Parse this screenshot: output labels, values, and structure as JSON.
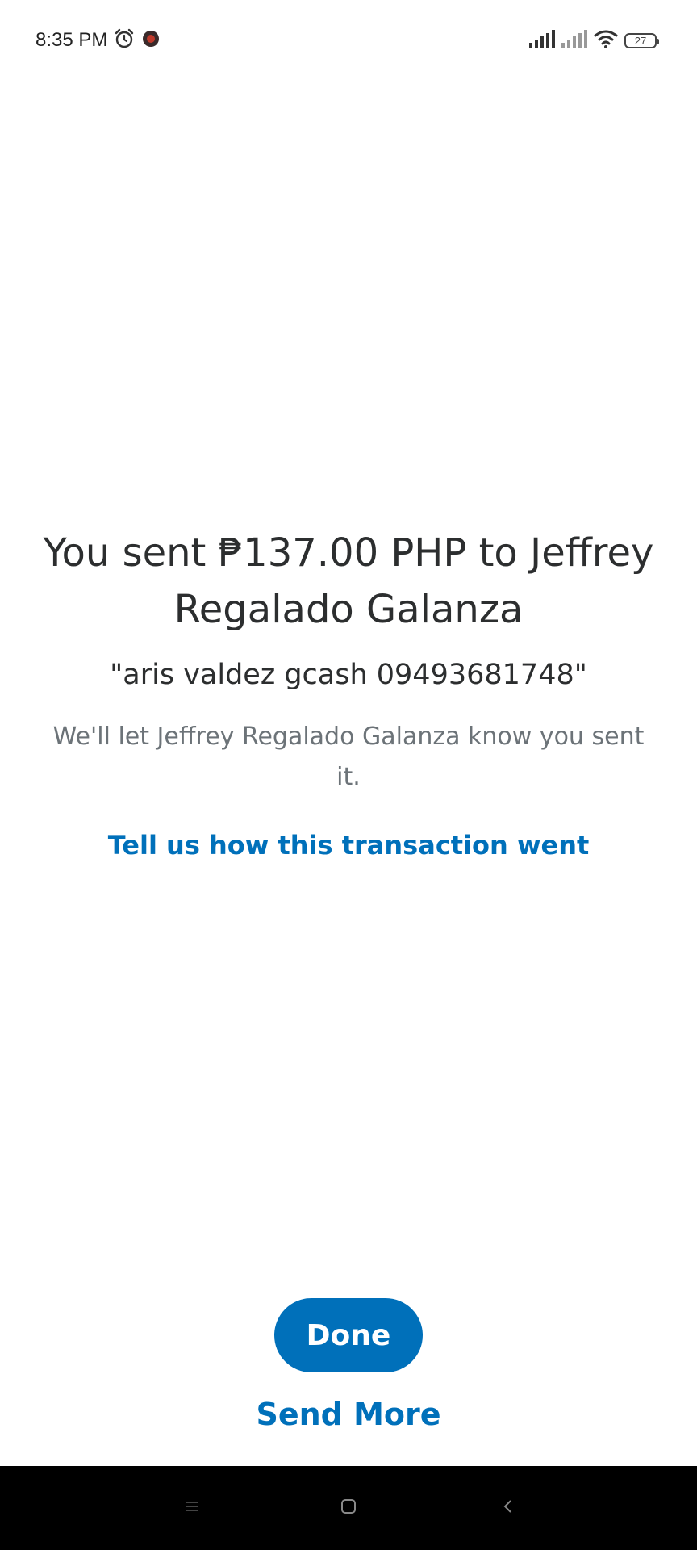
{
  "status_bar": {
    "time": "8:35 PM",
    "battery": "27"
  },
  "main": {
    "headline": "You sent ₱137.00 PHP to Jeffrey Regalado Galanza",
    "memo": "\"aris valdez gcash 09493681748\"",
    "notice": "We'll let Jeffrey Regalado Galanza know you sent it.",
    "feedback_link": "Tell us how this transaction went"
  },
  "actions": {
    "done_label": "Done",
    "send_more_label": "Send More"
  },
  "colors": {
    "accent": "#0070ba",
    "text_primary": "#2c2e2f",
    "text_secondary": "#6c7378"
  }
}
